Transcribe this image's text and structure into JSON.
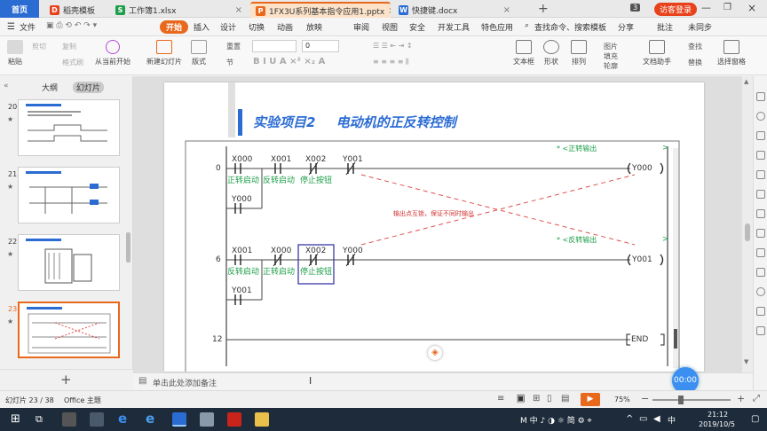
{
  "tabs": {
    "home": "首页",
    "items": [
      {
        "label": "稻壳模板",
        "icon_color": "#e8421c",
        "icon": "daoke-icon"
      },
      {
        "label": "工作簿1.xlsx",
        "icon_color": "#1e9e4a",
        "icon": "spreadsheet-icon"
      },
      {
        "label": "1FX3U系列基本指令应用1.pptx",
        "icon_color": "#e8681c",
        "icon": "presentation-icon",
        "active": true
      },
      {
        "label": "快捷键.docx",
        "icon_color": "#2b6cd3",
        "icon": "document-icon"
      }
    ],
    "badge": "3",
    "login": "访客登录"
  },
  "ribbon_tabs": [
    "文件",
    "开始",
    "插入",
    "设计",
    "切换",
    "动画",
    "放映",
    "审阅",
    "视图",
    "安全",
    "开发工具",
    "特色应用"
  ],
  "ribbon_search": "查找命令、搜索模板",
  "ribbon_right": [
    "分享",
    "批注",
    "未同步"
  ],
  "ribbon": {
    "paste": "粘贴",
    "cut": "剪切",
    "copy": "复制",
    "format_painter": "格式刷",
    "play_from": "从当前开始",
    "new_slide": "新建幻灯片",
    "layout": "版式",
    "section": "节",
    "reset": "重置",
    "font_size": "0",
    "textbox": "文本框",
    "shape": "形状",
    "arrange": "排列",
    "picture": "图片",
    "fill": "填充",
    "outline": "轮廓",
    "text_assistant": "文档助手",
    "find": "查找",
    "replace": "替换",
    "select_pane": "选择窗格"
  },
  "left_panel": {
    "outline": "大纲",
    "slides": "幻灯片",
    "thumbs": [
      {
        "num": "20"
      },
      {
        "num": "21"
      },
      {
        "num": "22"
      },
      {
        "num": "23",
        "selected": true
      }
    ],
    "add": "+"
  },
  "slide": {
    "title_prefix": "实验项目2",
    "title": "电动机的正反转控制",
    "rung1": {
      "step": "0",
      "comment": "* <正转输出",
      "contacts": [
        {
          "addr": "X000",
          "label": "正转启动"
        },
        {
          "addr": "X001",
          "label": "反转启动"
        },
        {
          "addr": "X002",
          "label": "停止按钮"
        },
        {
          "addr": "Y001",
          "label": ""
        }
      ],
      "latch": "Y000",
      "coil": "Y000"
    },
    "rung2": {
      "step": "6",
      "comment": "* <反转输出",
      "contacts": [
        {
          "addr": "X001",
          "label": "反转启动"
        },
        {
          "addr": "X000",
          "label": "正转启动"
        },
        {
          "addr": "X002",
          "label": "停止按钮"
        },
        {
          "addr": "Y000",
          "label": ""
        }
      ],
      "latch": "Y001",
      "coil": "Y001"
    },
    "rung3": {
      "step": "12",
      "coil": "END"
    },
    "annotation": "输出点互锁，保证不同时输出",
    "arrow_right": ">"
  },
  "notes": "单击此处添加备注",
  "status": {
    "slide_pos": "幻灯片 23 / 38",
    "theme": "Office 主题",
    "zoom": "75%",
    "timer": "00:00"
  },
  "taskbar": {
    "ime": "M 中 ♪ ◑ ☼ 简 ⚙ ⌖",
    "time": "21:12",
    "date": "2019/10/5",
    "colors": {
      "task": "#1d2b3a",
      "accent": "#e8681c",
      "blue": "#2b6cd3"
    }
  }
}
